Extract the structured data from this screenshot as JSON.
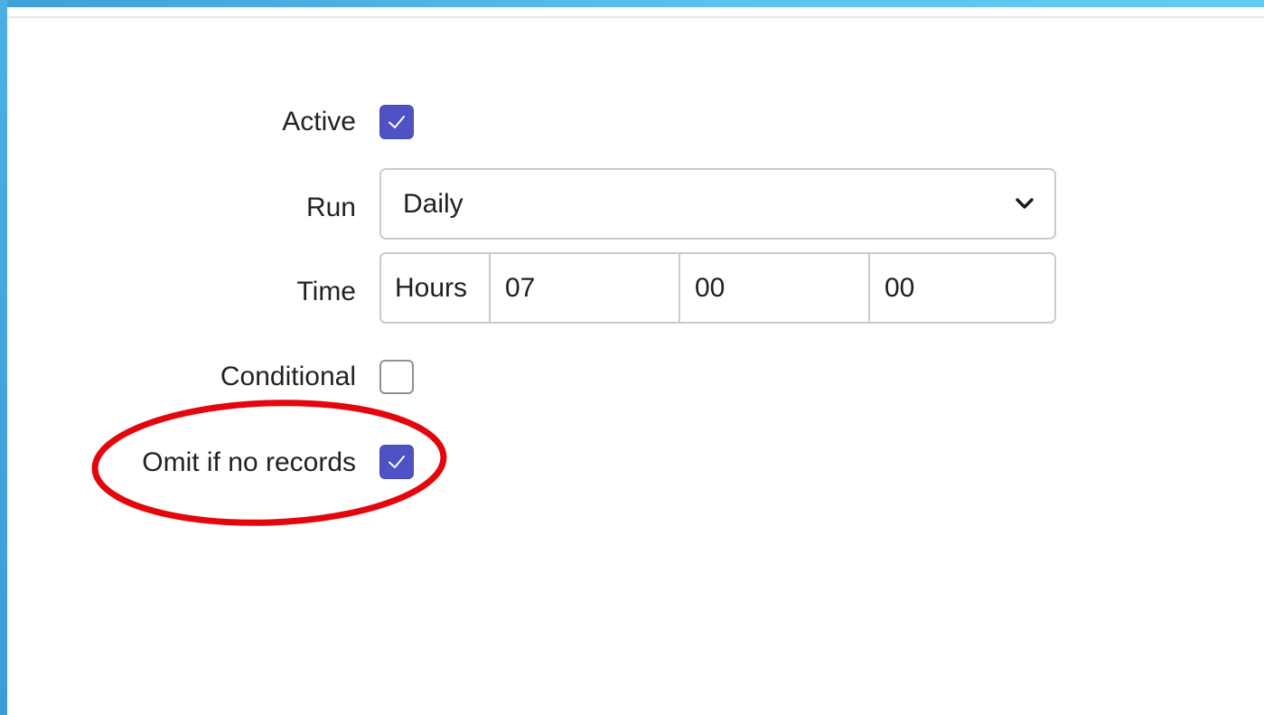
{
  "form": {
    "active": {
      "label": "Active",
      "checked": true
    },
    "run": {
      "label": "Run",
      "selected": "Daily",
      "icon": "chevron-down-icon"
    },
    "time": {
      "label": "Time",
      "addon": "Hours",
      "hours": "07",
      "minutes": "00",
      "seconds": "00"
    },
    "conditional": {
      "label": "Conditional",
      "checked": false
    },
    "omit_if_no_records": {
      "label": "Omit if no records",
      "checked": true
    }
  },
  "colors": {
    "checkbox_checked": "#4e52c4",
    "annotation": "#e3060c",
    "frame_accent": "#4ab0e4"
  }
}
